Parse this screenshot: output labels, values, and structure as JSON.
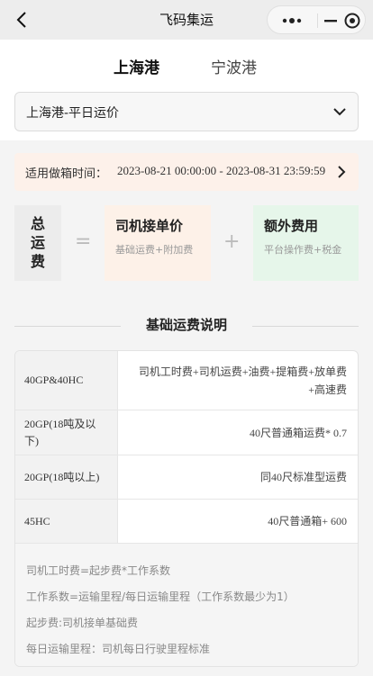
{
  "header": {
    "title": "飞码集运"
  },
  "tabs": [
    {
      "label": "上海港",
      "active": true
    },
    {
      "label": "宁波港",
      "active": false
    }
  ],
  "select": {
    "value": "上海港-平日运价"
  },
  "date_bar": {
    "label": "适用做箱时间：",
    "value": "2023-08-21 00:00:00 - 2023-08-31 23:59:59"
  },
  "formula": {
    "total_label": "总运费",
    "equals": "=",
    "plus": "+",
    "driver": {
      "title": "司机接单价",
      "subtitle": "基础运费+附加费"
    },
    "extra": {
      "title": "额外费用",
      "subtitle": "平台操作费+税金"
    }
  },
  "section": {
    "title": "基础运费说明"
  },
  "table": {
    "rows": [
      {
        "key": "40GP&40HC",
        "value": "司机工时费+司机运费+油费+提箱费+放单费+高速费"
      },
      {
        "key": "20GP(18吨及以下)",
        "value": "40尺普通箱运费* 0.7"
      },
      {
        "key": "20GP(18吨以上)",
        "value": "同40尺标准型运费"
      },
      {
        "key": "45HC",
        "value": "40尺普通箱+ 600"
      }
    ],
    "notes": [
      "司机工时费=起步费*工作系数",
      "工作系数=运输里程/每日运输里程（工作系数最少为1）",
      "起步费:司机接单基础费",
      "每日运输里程：司机每日行驶里程标准"
    ]
  },
  "colors": {
    "date_bg": "#fdf1ea",
    "driver_bg": "#fdf1e8",
    "extra_bg": "#e6f6ea"
  }
}
